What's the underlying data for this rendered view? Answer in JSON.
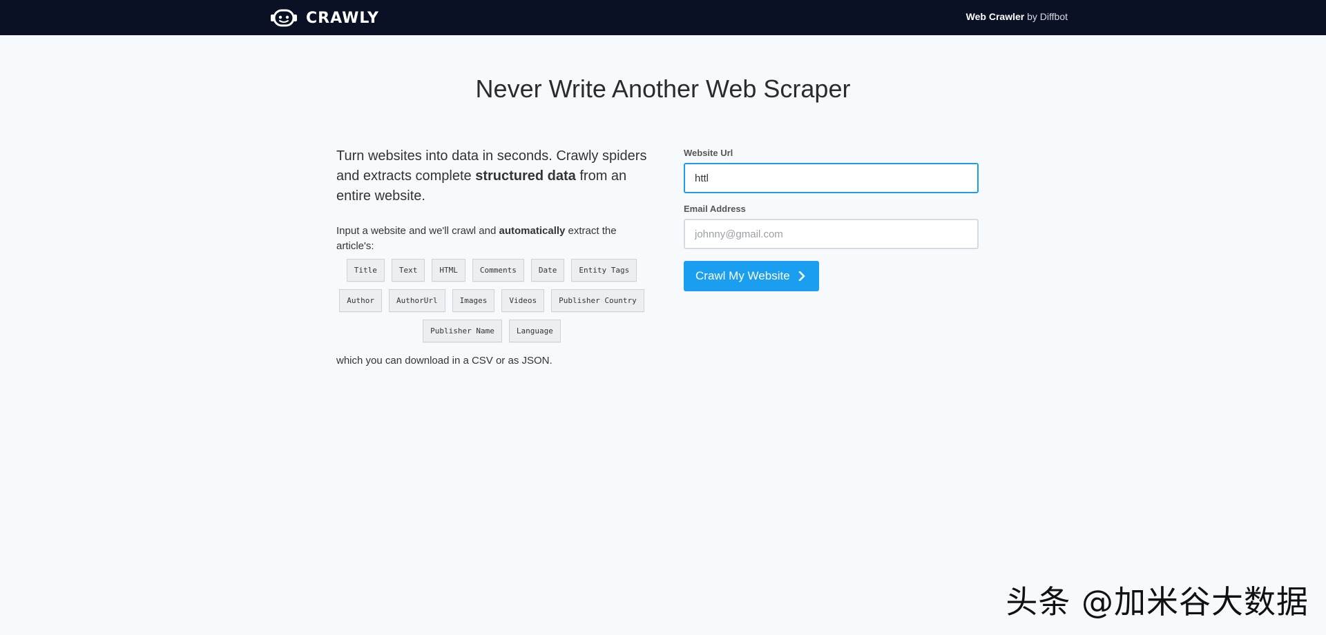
{
  "header": {
    "logo_text": "CRAWLY",
    "brand_strong": "Web Crawler",
    "brand_light": "by Diffbot",
    "logo_icon": "robot-head-icon",
    "background_color": "#0b1124"
  },
  "hero": {
    "title": "Never Write Another Web Scraper"
  },
  "intro": {
    "lead_part1": "Turn websites into data in seconds. Crawly spiders and extracts complete ",
    "lead_bold": "structured data",
    "lead_part2": " from an entire website.",
    "sub_part1": "Input a website and we'll crawl and ",
    "sub_bold": "automatically",
    "sub_part2": " extract the article's:"
  },
  "tags": [
    "Title",
    "Text",
    "HTML",
    "Comments",
    "Date",
    "Entity Tags",
    "Author",
    "AuthorUrl",
    "Images",
    "Videos",
    "Publisher Country",
    "Publisher Name",
    "Language"
  ],
  "download_note": "which you can download in a CSV or as JSON.",
  "form": {
    "url_label": "Website Url",
    "url_value": "httl",
    "email_label": "Email Address",
    "email_placeholder": "johnny@gmail.com",
    "submit_label": "Crawl My Website",
    "accent_color": "#1a9ff0"
  },
  "watermark": "头条 @加米谷大数据"
}
